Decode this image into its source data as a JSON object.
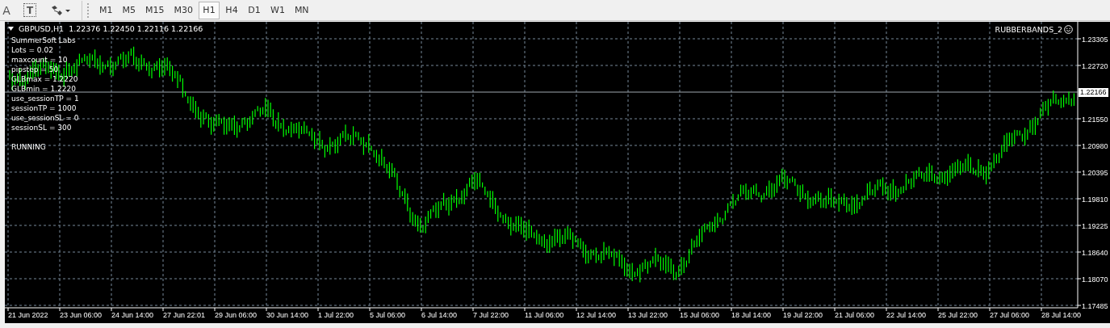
{
  "toolbar": {
    "tools": [
      {
        "kind": "glyph",
        "label": "A"
      },
      {
        "kind": "boxed",
        "label": "T"
      },
      {
        "kind": "shapes"
      }
    ],
    "timeframes": [
      {
        "label": "M1",
        "selected": false
      },
      {
        "label": "M5",
        "selected": false
      },
      {
        "label": "M15",
        "selected": false
      },
      {
        "label": "M30",
        "selected": false
      },
      {
        "label": "H1",
        "selected": true
      },
      {
        "label": "H4",
        "selected": false
      },
      {
        "label": "D1",
        "selected": false
      },
      {
        "label": "W1",
        "selected": false
      },
      {
        "label": "MN",
        "selected": false
      }
    ]
  },
  "chart": {
    "symbol": "GBPUSD,H1",
    "quote": "1.22376 1.22450 1.22116 1.22166",
    "expert": "RUBBERBANDS_2",
    "current_price": "1.22166",
    "info_lines": [
      "SummerSoft Labs",
      "Lots = 0.02",
      "maxcount = 10",
      "pipstep = 50",
      "GLBmax = 1.2220",
      "GLBmin = 1.2220",
      "use_sessionTP = 1",
      "sessionTP = 1000",
      "use_sessionSL = 0",
      "sessionSL = 300"
    ],
    "status": "RUNNING",
    "price_scale": [
      "1.23305",
      "1.22720",
      "1.21550",
      "1.20980",
      "1.20395",
      "1.19810",
      "1.19225",
      "1.18640",
      "1.18070",
      "1.17485"
    ],
    "time_scale": [
      "21 Jun 2022",
      "23 Jun 06:00",
      "24 Jun 14:00",
      "27 Jun 22:01",
      "29 Jun 06:00",
      "30 Jun 14:00",
      "1 Jul 22:00",
      "5 Jul 06:00",
      "6 Jul 14:00",
      "7 Jul 22:00",
      "11 Jul 06:00",
      "12 Jul 14:00",
      "13 Jul 22:00",
      "15 Jul 06:00",
      "18 Jul 14:00",
      "19 Jul 22:00",
      "21 Jul 06:00",
      "22 Jul 14:00",
      "25 Jul 22:00",
      "27 Jul 06:00",
      "28 Jul 14:00"
    ]
  }
}
